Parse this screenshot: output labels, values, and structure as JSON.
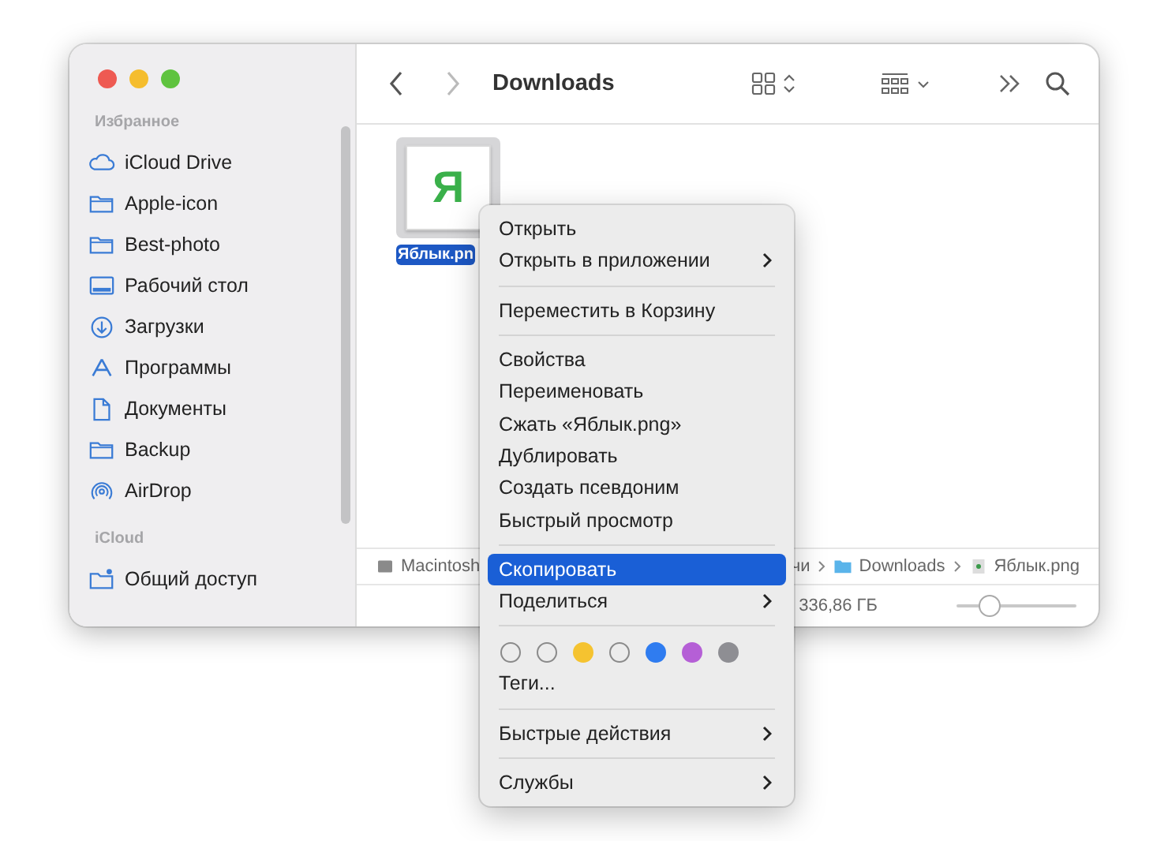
{
  "window": {
    "title": "Downloads"
  },
  "sidebar": {
    "sections": [
      {
        "heading": "Избранное",
        "items": [
          {
            "label": "iCloud Drive",
            "kind": "cloud",
            "selected": false
          },
          {
            "label": "Apple-icon",
            "kind": "folder",
            "selected": false
          },
          {
            "label": "Best-photo",
            "kind": "folder",
            "selected": false
          },
          {
            "label": "Рабочий стол",
            "kind": "desktop",
            "selected": false
          },
          {
            "label": "Загрузки",
            "kind": "download",
            "selected": false
          },
          {
            "label": "Программы",
            "kind": "apps",
            "selected": false
          },
          {
            "label": "Документы",
            "kind": "document",
            "selected": false
          },
          {
            "label": "Backup",
            "kind": "folder",
            "selected": false
          },
          {
            "label": "AirDrop",
            "kind": "airdrop",
            "selected": false
          }
        ]
      },
      {
        "heading": "iCloud",
        "items": [
          {
            "label": "Общий доступ",
            "kind": "shared",
            "selected": false
          }
        ]
      }
    ]
  },
  "files": [
    {
      "name": "Яблык.pn",
      "thumbnail_glyph": "Я",
      "selected": true
    }
  ],
  "path_bar": [
    {
      "label": "Macintosh",
      "kind": "disk"
    },
    {
      "label": "чи",
      "kind": "plain"
    },
    {
      "label": "Downloads",
      "kind": "folder"
    },
    {
      "label": "Яблык.png",
      "kind": "file"
    }
  ],
  "status_bar": {
    "text": "336,86 ГБ",
    "zoom": {
      "level": 0.28
    }
  },
  "context_menu": [
    {
      "kind": "item",
      "label": "Открыть",
      "submenu": false,
      "selected": false
    },
    {
      "kind": "item",
      "label": "Открыть в приложении",
      "submenu": true,
      "selected": false
    },
    {
      "kind": "separator"
    },
    {
      "kind": "item",
      "label": "Переместить в Корзину",
      "submenu": false,
      "selected": false
    },
    {
      "kind": "separator"
    },
    {
      "kind": "item",
      "label": "Свойства",
      "submenu": false,
      "selected": false
    },
    {
      "kind": "item",
      "label": "Переименовать",
      "submenu": false,
      "selected": false
    },
    {
      "kind": "item",
      "label": "Сжать «Яблык.png»",
      "submenu": false,
      "selected": false
    },
    {
      "kind": "item",
      "label": "Дублировать",
      "submenu": false,
      "selected": false
    },
    {
      "kind": "item",
      "label": "Создать псевдоним",
      "submenu": false,
      "selected": false
    },
    {
      "kind": "item",
      "label": "Быстрый просмотр",
      "submenu": false,
      "selected": false
    },
    {
      "kind": "separator"
    },
    {
      "kind": "item",
      "label": "Скопировать",
      "submenu": false,
      "selected": true
    },
    {
      "kind": "item",
      "label": "Поделиться",
      "submenu": true,
      "selected": false
    },
    {
      "kind": "separator"
    },
    {
      "kind": "tags",
      "tags": [
        {
          "kind": "outline"
        },
        {
          "kind": "outline"
        },
        {
          "kind": "fill",
          "color": "#f5c330"
        },
        {
          "kind": "outline"
        },
        {
          "kind": "fill",
          "color": "#2f7cf0"
        },
        {
          "kind": "fill",
          "color": "#b55fd6"
        },
        {
          "kind": "fill",
          "color": "#8e8e93"
        }
      ]
    },
    {
      "kind": "item",
      "label": "Теги...",
      "submenu": false,
      "selected": false
    },
    {
      "kind": "separator"
    },
    {
      "kind": "item",
      "label": "Быстрые действия",
      "submenu": true,
      "selected": false
    },
    {
      "kind": "separator"
    },
    {
      "kind": "item",
      "label": "Службы",
      "submenu": true,
      "selected": false
    }
  ]
}
